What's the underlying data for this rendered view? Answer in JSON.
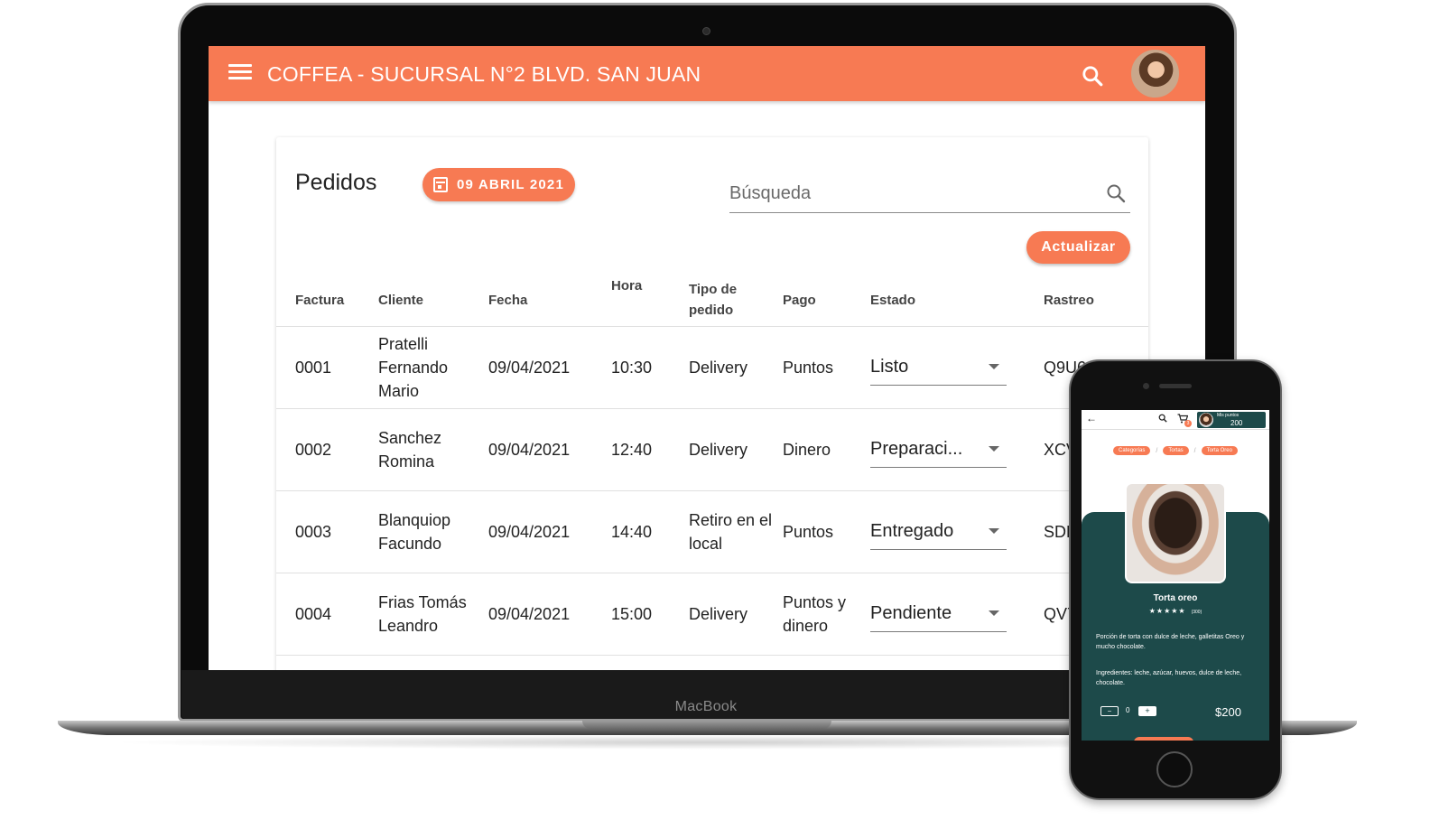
{
  "laptop": {
    "brand_label": "MacBook"
  },
  "appbar": {
    "title": "COFFEA - SUCURSAL N°2 BLVD. SAN JUAN",
    "menu_icon": "menu-icon",
    "search_icon": "search-icon",
    "accent_color": "#f77a53"
  },
  "orders": {
    "title": "Pedidos",
    "date_chip": "09 ABRIL 2021",
    "search_placeholder": "Búsqueda",
    "refresh_label": "Actualizar",
    "columns": {
      "factura": "Factura",
      "cliente": "Cliente",
      "fecha": "Fecha",
      "hora": "Hora",
      "tipo": "Tipo de pedido",
      "pago": "Pago",
      "estado": "Estado",
      "rastreo": "Rastreo"
    },
    "rows": [
      {
        "factura": "0001",
        "cliente": "Pratelli Fernando Mario",
        "fecha": "09/04/2021",
        "hora": "10:30",
        "tipo": "Delivery",
        "pago": "Puntos",
        "estado": "Listo",
        "rastreo": "Q9U6"
      },
      {
        "factura": "0002",
        "cliente": "Sanchez Romina",
        "fecha": "09/04/2021",
        "hora": "12:40",
        "tipo": "Delivery",
        "pago": "Dinero",
        "estado": "Preparaci...",
        "rastreo": "XCV"
      },
      {
        "factura": "0003",
        "cliente": "Blanquiop Facundo",
        "fecha": "09/04/2021",
        "hora": "14:40",
        "tipo": "Retiro en el local",
        "pago": "Puntos",
        "estado": "Entregado",
        "rastreo": "SDK"
      },
      {
        "factura": "0004",
        "cliente": "Frias Tomás Leandro",
        "fecha": "09/04/2021",
        "hora": "15:00",
        "tipo": "Delivery",
        "pago": "Puntos y dinero",
        "estado": "Pendiente",
        "rastreo": "QV7"
      }
    ]
  },
  "phone": {
    "points_label": "Mis puntos",
    "points_value": "200",
    "cart_count": "3",
    "breadcrumbs": [
      "Categorías",
      "Tortas",
      "Torta Oreo"
    ],
    "product_name": "Torta oreo",
    "stars": "★★★★★",
    "rating_count": "(300)",
    "description": "Porción de torta con dulce de leche, galletitas Oreo y mucho chocolate.",
    "ingredients": "Ingredientes: leche, azúcar, huevos, dulce de leche, chocolate.",
    "quantity": "0",
    "price": "$200",
    "panel_color": "#1d4a4a"
  }
}
